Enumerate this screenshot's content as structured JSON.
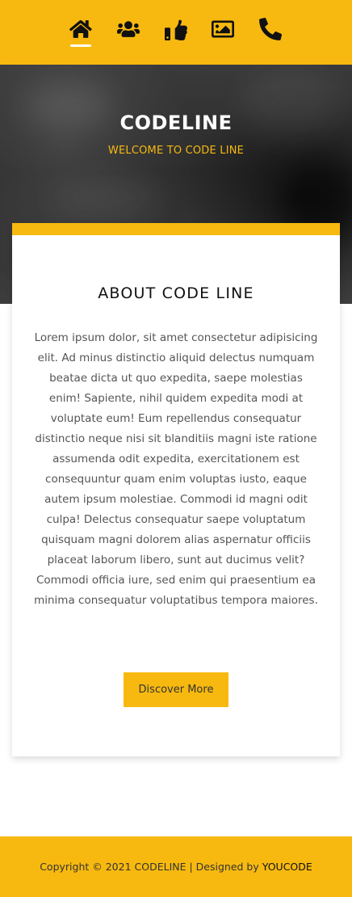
{
  "nav": {
    "items": [
      {
        "icon": "home-icon",
        "active": true
      },
      {
        "icon": "users-icon",
        "active": false
      },
      {
        "icon": "thumbs-up-icon",
        "active": false
      },
      {
        "icon": "image-icon",
        "active": false
      },
      {
        "icon": "phone-icon",
        "active": false
      }
    ],
    "background": "#f7b90f"
  },
  "hero": {
    "title": "CODELINE",
    "subtitle": "WELCOME TO CODE LINE"
  },
  "about": {
    "title": "ABOUT CODE LINE",
    "text": "Lorem ipsum dolor, sit amet consectetur adipisicing elit. Ad minus distinctio aliquid delectus numquam beatae dicta ut quo expedita, saepe molestias enim! Sapiente, nihil quidem expedita modi at voluptate eum! Eum repellendus consequatur distinctio neque nisi sit blanditiis magni iste ratione assumenda odit expedita, exercitationem est consequuntur quam enim voluptas iusto, eaque autem ipsum molestiae. Commodi id magni odit culpa! Delectus consequatur saepe voluptatum quisquam magni dolorem alias aspernatur officiis placeat laborum libero, sunt aut ducimus velit? Commodi officia iure, sed enim qui praesentium ea minima consequatur voluptatibus tempora maiores.",
    "button_label": "Discover More"
  },
  "footer": {
    "text": "Copyright © 2021 CODELINE | Designed by",
    "brand": "YOUCODE"
  },
  "colors": {
    "accent": "#f7b90f"
  }
}
